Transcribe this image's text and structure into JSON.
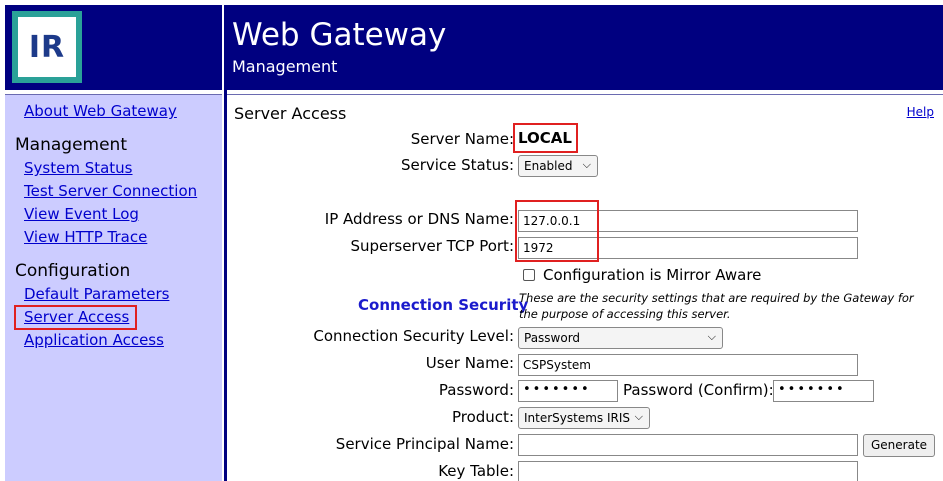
{
  "logo": {
    "text": "IR"
  },
  "header": {
    "title": "Web Gateway",
    "subtitle": "Management"
  },
  "sidebar": {
    "about": "About Web Gateway",
    "management_heading": "Management",
    "management_items": [
      "System Status",
      "Test Server Connection",
      "View Event Log",
      "View HTTP Trace"
    ],
    "configuration_heading": "Configuration",
    "configuration_items": [
      "Default Parameters",
      "Server Access",
      "Application Access"
    ],
    "selected_item": "Server Access"
  },
  "main": {
    "title": "Server Access",
    "help_link": "Help",
    "server_name_label": "Server Name:",
    "server_name_value": "LOCAL",
    "service_status_label": "Service Status:",
    "service_status_value": "Enabled",
    "ip_label": "IP Address or DNS Name:",
    "ip_value": "127.0.0.1",
    "port_label": "Superserver TCP Port:",
    "port_value": "1972",
    "mirror_aware_label": "Configuration is Mirror Aware",
    "mirror_aware_checked": false,
    "connection_security_heading": "Connection Security",
    "connection_security_note": "These are the security settings that are required by the Gateway for the purpose of accessing this server.",
    "security_level_label": "Connection Security Level:",
    "security_level_value": "Password",
    "user_name_label": "User Name:",
    "user_name_value": "CSPSystem",
    "password_label": "Password:",
    "password_value": "•••••••",
    "password_confirm_label": "Password (Confirm):",
    "password_confirm_value": "•••••••",
    "product_label": "Product:",
    "product_value": "InterSystems IRIS",
    "spn_label": "Service Principal Name:",
    "spn_value": "",
    "generate_button": "Generate",
    "key_table_label": "Key Table:",
    "key_table_value": ""
  },
  "icons": {
    "dropdown": "chevron-down-icon",
    "checkbox": "checkbox-unchecked-icon"
  },
  "colors": {
    "header_bg": "#000080",
    "sidebar_bg": "#ccccff",
    "link": "#0000cc",
    "highlight_box": "#e02020",
    "section_heading": "#1a1acc"
  }
}
